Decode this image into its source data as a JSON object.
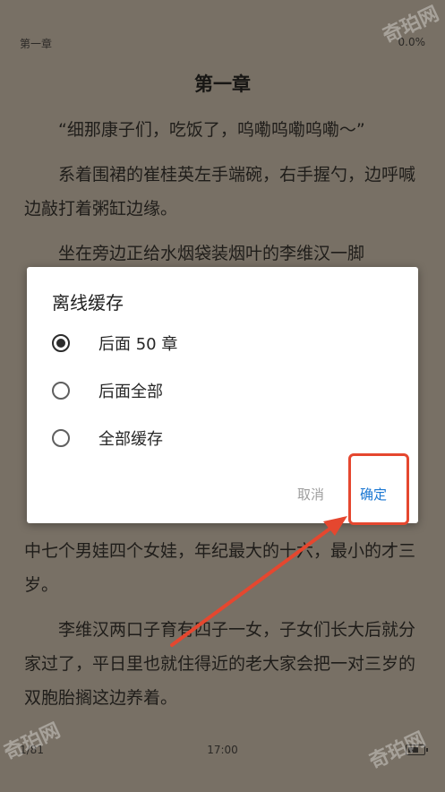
{
  "status": {
    "chapter_short": "第一章",
    "progress": "0.0%",
    "page": "1/81",
    "time": "17:00",
    "battery_level": 0.75
  },
  "reader": {
    "chapter_title": "第一章",
    "paragraphs_top": [
      "“细那康子们，吃饭了，呜嘞呜嘞呜嘞～”",
      "系着围裙的崔桂英左手端碗，右手握勺，边呼喊边敲打着粥缸边缘。",
      "坐在旁边正给水烟袋装烟叶的李维汉一脚"
    ],
    "paragraphs_bottom": [
      "中七个男娃四个女娃，年纪最大的十六，最小的才三岁。",
      "李维汉两口子育有四子一女，子女们长大后就分家过了，平日里也就住得近的老大家会把一对三岁的双胞胎搁这边养着。"
    ]
  },
  "dialog": {
    "title": "离线缓存",
    "options": [
      {
        "label": "后面 50 章",
        "checked": true
      },
      {
        "label": "后面全部",
        "checked": false
      },
      {
        "label": "全部缓存",
        "checked": false
      }
    ],
    "cancel_label": "取消",
    "ok_label": "确定"
  },
  "watermark": "奇珀网",
  "colors": {
    "background": "#787065",
    "accent": "#1976d2",
    "annotation": "#e5472f"
  }
}
